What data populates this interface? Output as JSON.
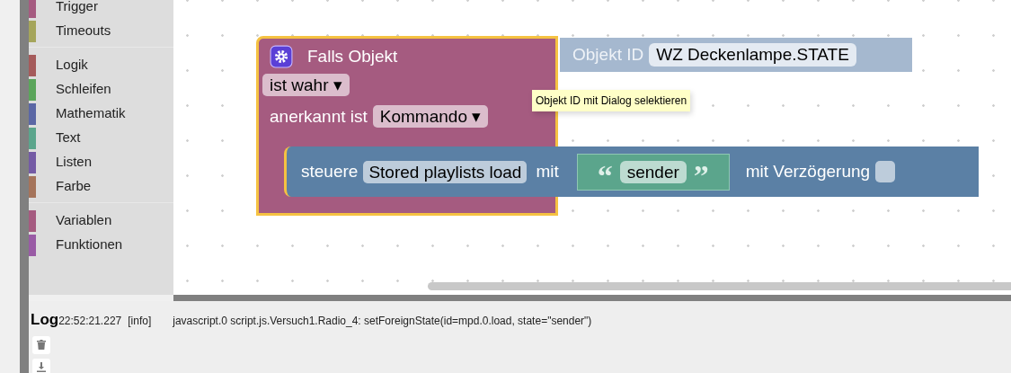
{
  "toolbox": {
    "groups": [
      [
        {
          "label": "Trigger",
          "color": "#a55b80"
        },
        {
          "label": "Timeouts",
          "color": "#a5a55b"
        }
      ],
      [
        {
          "label": "Logik",
          "color": "#a55b5b"
        },
        {
          "label": "Schleifen",
          "color": "#5ba55b"
        },
        {
          "label": "Mathematik",
          "color": "#5b67a5"
        },
        {
          "label": "Text",
          "color": "#5ba58c"
        },
        {
          "label": "Listen",
          "color": "#745ba5"
        },
        {
          "label": "Farbe",
          "color": "#a5745b"
        }
      ],
      [
        {
          "label": "Variablen",
          "color": "#a55b80"
        },
        {
          "label": "Funktionen",
          "color": "#995ba5"
        }
      ]
    ]
  },
  "workspace": {
    "trigger_block": {
      "title": "Falls Objekt",
      "condition": "ist wahr ▾",
      "ack_label": "anerkannt ist",
      "ack_value": "Kommando ▾",
      "selected": true
    },
    "object_id_block": {
      "label": "Objekt ID",
      "value": "WZ Deckenlampe.STATE"
    },
    "tooltip": "Objekt ID mit Dialog selektieren",
    "control_block": {
      "label": "steuere",
      "target": "Stored playlists load",
      "with": "mit",
      "delay_label": "mit Verzögerung",
      "delay_checked": false
    },
    "text_block": {
      "open_quote": "“",
      "value": "sender",
      "close_quote": "”"
    }
  },
  "log": {
    "title": "Log",
    "entries": [
      {
        "time": "22:52:21.227",
        "level": "[info]",
        "message": "javascript.0 script.js.Versuch1.Radio_4: setForeignState(id=mpd.0.load, state=\"sender\")"
      }
    ]
  }
}
